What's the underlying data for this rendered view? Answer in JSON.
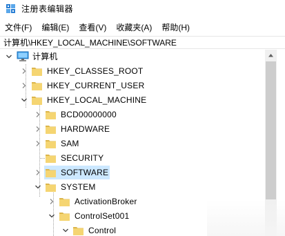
{
  "window": {
    "title": "注册表编辑器"
  },
  "menu": {
    "file": "文件(F)",
    "edit": "编辑(E)",
    "view": "查看(V)",
    "favorites": "收藏夹(A)",
    "help": "帮助(H)"
  },
  "address": {
    "path": "计算机\\HKEY_LOCAL_MACHINE\\SOFTWARE"
  },
  "tree": {
    "computer": "计算机",
    "hkcr": "HKEY_CLASSES_ROOT",
    "hkcu": "HKEY_CURRENT_USER",
    "hklm": "HKEY_LOCAL_MACHINE",
    "bcd": "BCD00000000",
    "hardware": "HARDWARE",
    "sam": "SAM",
    "security": "SECURITY",
    "software": "SOFTWARE",
    "system": "SYSTEM",
    "activationbroker": "ActivationBroker",
    "controlset001": "ControlSet001",
    "control": "Control"
  },
  "colors": {
    "selection": "#cce8ff",
    "folder": "#f5d572",
    "folder_dark": "#dcb54a"
  }
}
